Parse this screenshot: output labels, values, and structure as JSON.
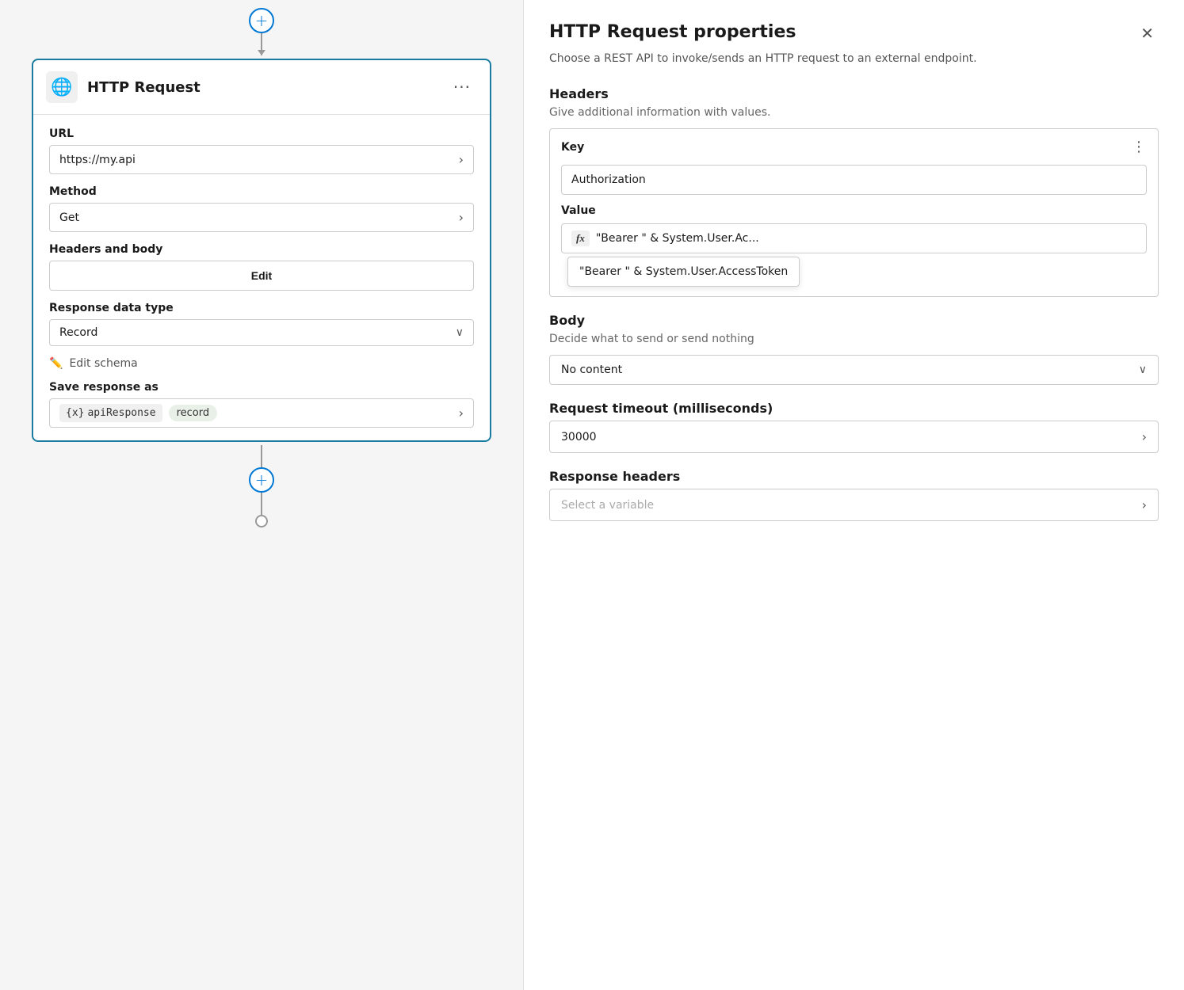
{
  "left": {
    "plus_top": "+",
    "card_title": "HTTP Request",
    "card_icon": "🌐",
    "card_menu": "···",
    "url_label": "URL",
    "url_value": "https://my.api",
    "method_label": "Method",
    "method_value": "Get",
    "headers_body_label": "Headers and body",
    "edit_btn": "Edit",
    "response_data_type_label": "Response data type",
    "response_data_type_value": "Record",
    "edit_schema_label": "Edit schema",
    "save_response_label": "Save response as",
    "var_icon": "{x}",
    "var_name": "apiResponse",
    "var_type": "record",
    "plus_bottom": "+"
  },
  "right": {
    "title": "HTTP Request properties",
    "close": "✕",
    "description": "Choose a REST API to invoke/sends an HTTP request to an external endpoint.",
    "headers_title": "Headers",
    "headers_desc": "Give additional information with values.",
    "key_label": "Key",
    "key_value": "Authorization",
    "value_label": "Value",
    "value_fx": "fx",
    "value_text": "\"Bearer \" & System.User.Ac...",
    "tooltip_text": "\"Bearer \" & System.User.AccessToken",
    "body_title": "Body",
    "body_desc": "Decide what to send or send nothing",
    "body_value": "No content",
    "timeout_title": "Request timeout (milliseconds)",
    "timeout_value": "30000",
    "response_headers_title": "Response headers",
    "select_var_placeholder": "Select a variable"
  }
}
